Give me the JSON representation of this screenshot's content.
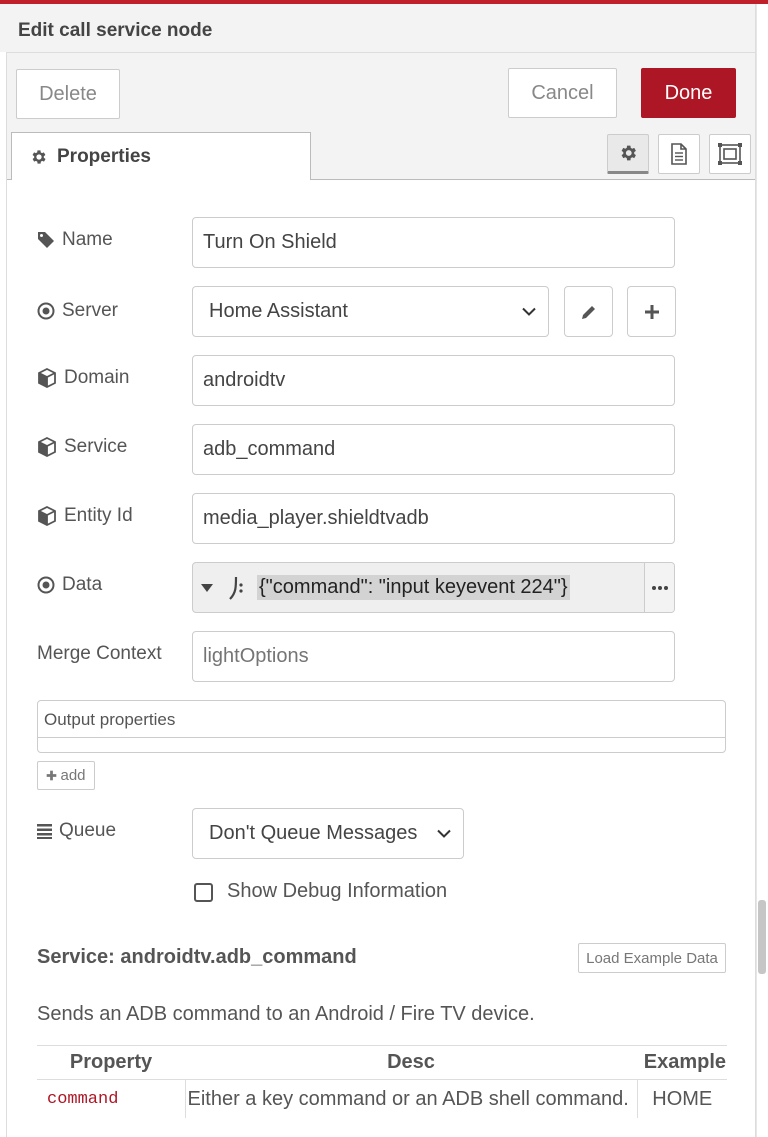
{
  "tray": {
    "title": "Edit call service node"
  },
  "toolbar": {
    "delete_label": "Delete",
    "cancel_label": "Cancel",
    "done_label": "Done"
  },
  "tabs": {
    "properties_label": "Properties"
  },
  "form": {
    "name_label": "Name",
    "name_value": "Turn On Shield",
    "server_label": "Server",
    "server_value": "Home Assistant",
    "domain_label": "Domain",
    "domain_value": "androidtv",
    "service_label": "Service",
    "service_value": "adb_command",
    "entity_label": "Entity Id",
    "entity_value": "media_player.shieldtvadb",
    "data_label": "Data",
    "data_value": "{\"command\": \"input keyevent 224\"}",
    "merge_label": "Merge Context",
    "merge_placeholder": "lightOptions",
    "output_label": "Output properties",
    "add_label": "add",
    "queue_label": "Queue",
    "queue_value": "Don't Queue Messages",
    "debug_label": "Show Debug Information",
    "debug_checked": false
  },
  "service_info": {
    "title": "Service: androidtv.adb_command",
    "load_example_label": "Load Example Data",
    "description": "Sends an ADB command to an Android / Fire TV device.",
    "columns": [
      "Property",
      "Desc",
      "Example"
    ],
    "rows": [
      {
        "property": "command",
        "desc": "Either a key command or an ADB shell command.",
        "example": "HOME"
      }
    ]
  },
  "colors": {
    "accent": "#ad1625",
    "border": "#cccccc",
    "tray_bg": "#f3f3f3"
  }
}
